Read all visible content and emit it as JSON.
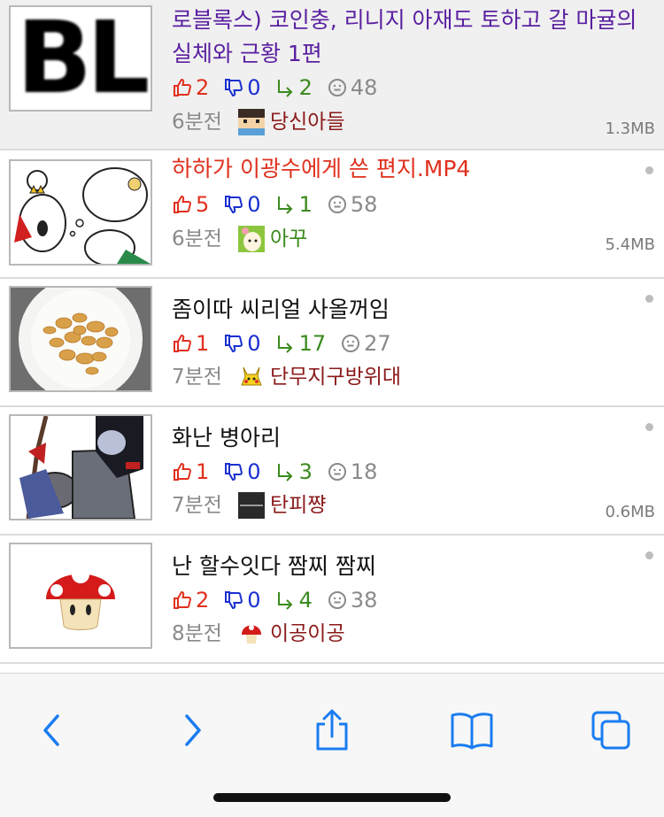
{
  "posts": [
    {
      "title": "로블록스) 코인충, 리니지 아재도 토하고 갈 마귤의 실체와 근황 1편",
      "up": "2",
      "down": "0",
      "replies": "2",
      "views": "48",
      "time": "6분전",
      "author": "당신아들",
      "size": "1.3MB"
    },
    {
      "title": "하하가 이광수에게 쓴 편지.MP4",
      "up": "5",
      "down": "0",
      "replies": "1",
      "views": "58",
      "time": "6분전",
      "author": "아꾸",
      "size": "5.4MB"
    },
    {
      "title": "좀이따 씨리얼 사올꺼임",
      "up": "1",
      "down": "0",
      "replies": "17",
      "views": "27",
      "time": "7분전",
      "author": "단무지구방위대",
      "size": ""
    },
    {
      "title": "화난 병아리",
      "up": "1",
      "down": "0",
      "replies": "3",
      "views": "18",
      "time": "7분전",
      "author": "탄피쨩",
      "size": "0.6MB"
    },
    {
      "title": "난 할수잇다 짬찌 짬찌",
      "up": "2",
      "down": "0",
      "replies": "4",
      "views": "38",
      "time": "8분전",
      "author": "이공이공",
      "size": ""
    }
  ],
  "thumb_text": {
    "first": "BL"
  },
  "colors": {
    "up": "#e0301e",
    "down": "#1a2fd0",
    "reply": "#3b8a1e",
    "visited": "#5a1fa0",
    "author": "#8b1a1a"
  },
  "toolbar": {
    "icons": [
      "back-icon",
      "forward-icon",
      "share-icon",
      "bookmarks-icon",
      "tabs-icon"
    ]
  }
}
